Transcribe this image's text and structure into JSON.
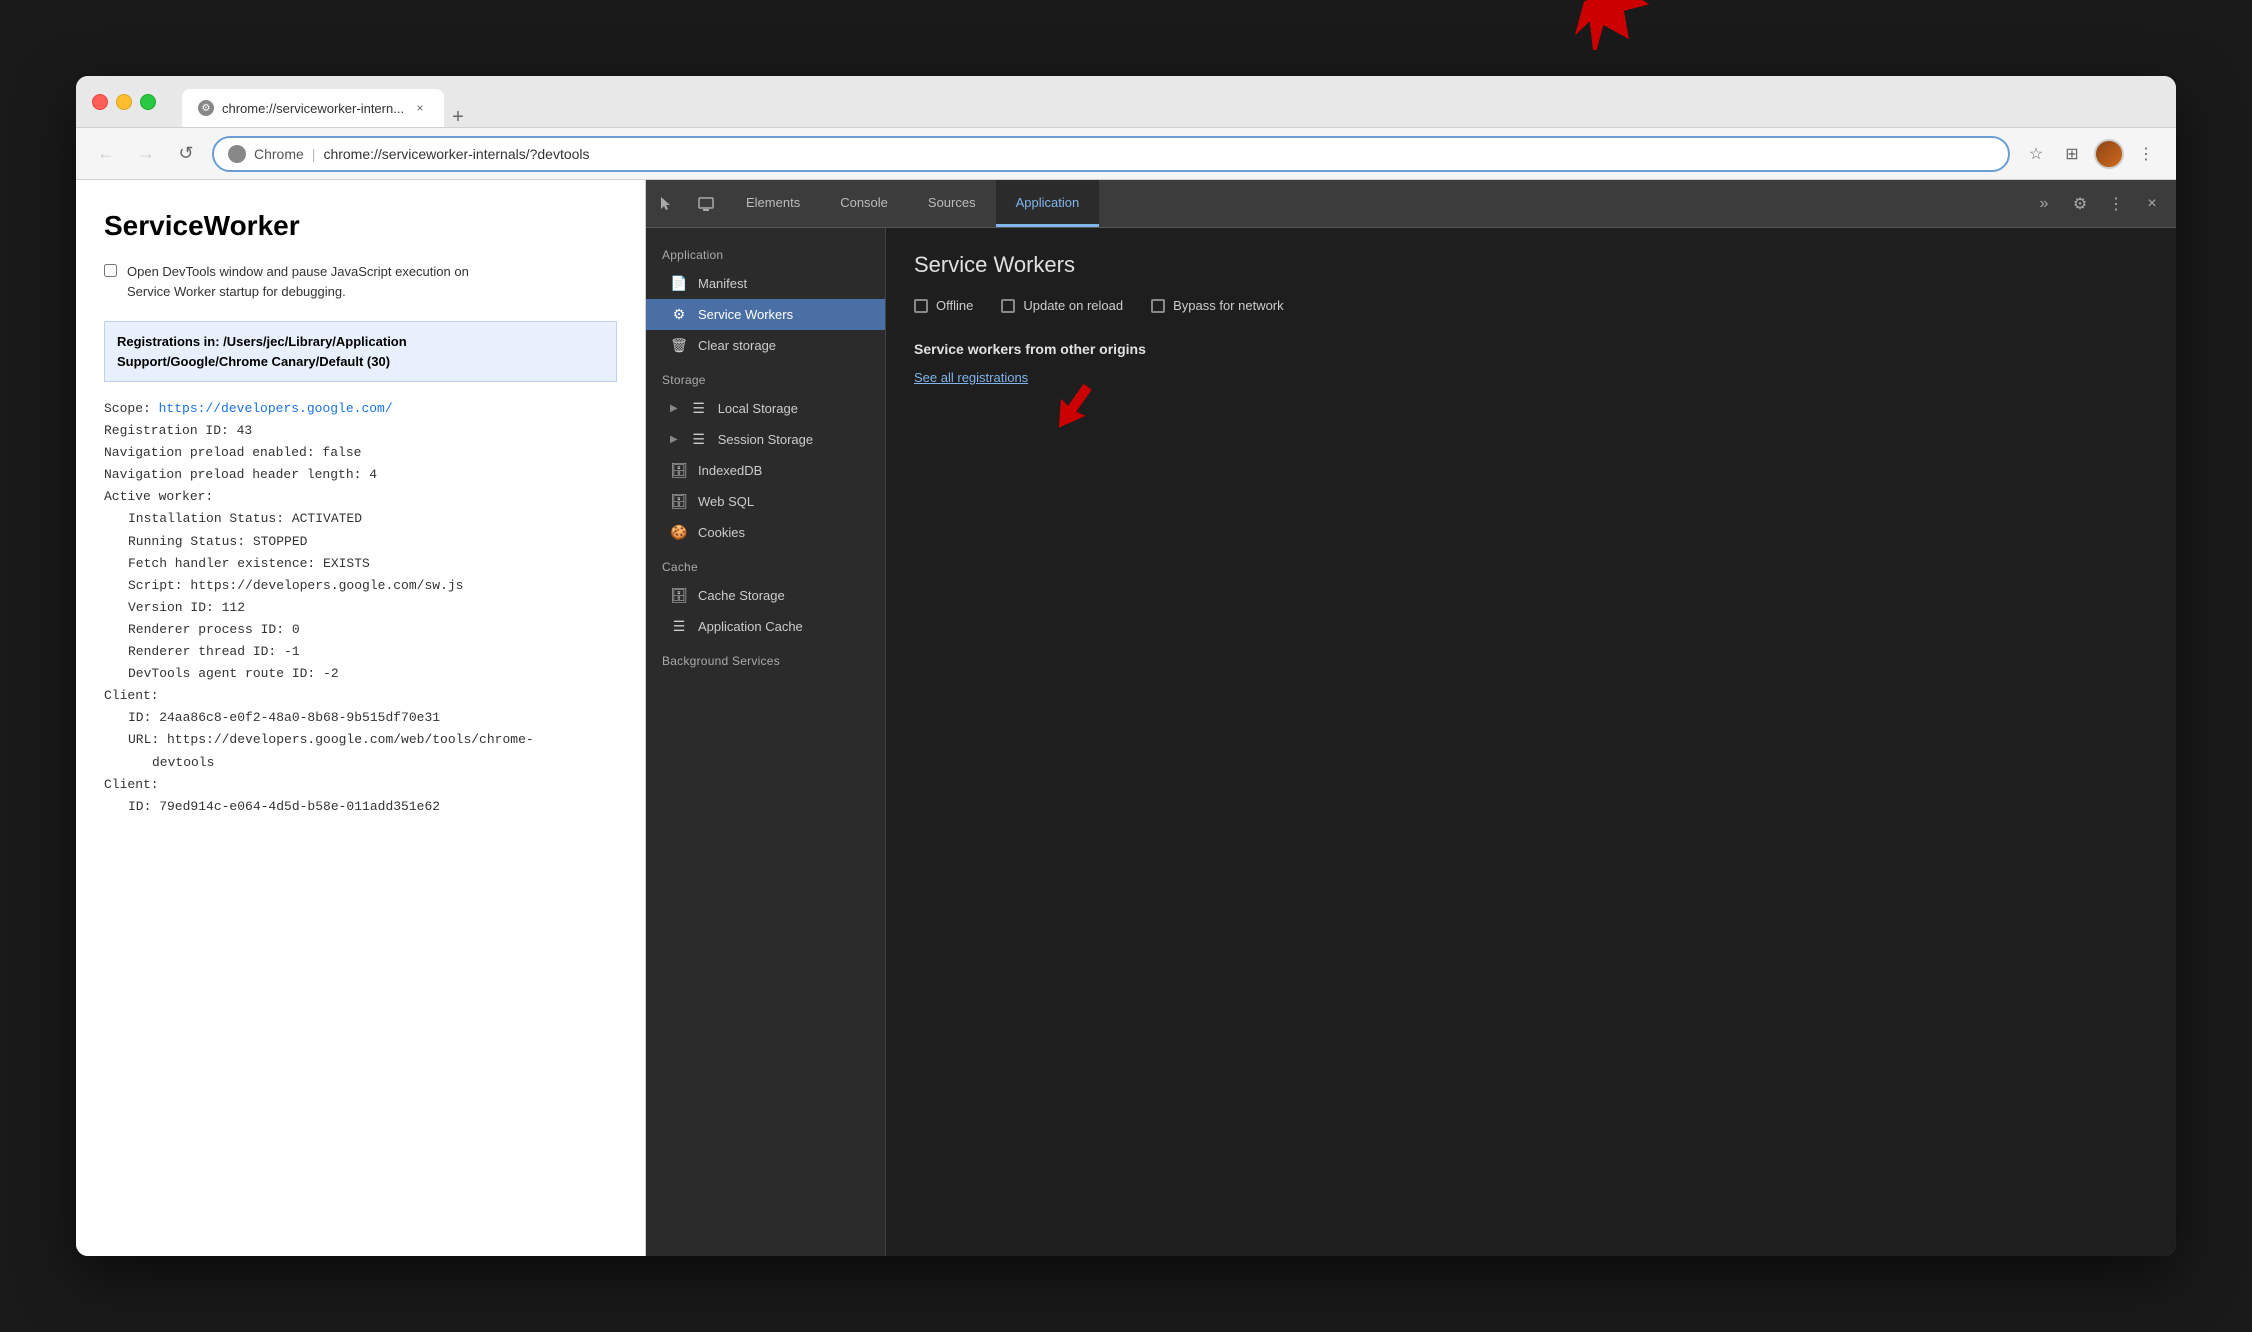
{
  "browser": {
    "traffic_lights": [
      "close",
      "minimize",
      "maximize"
    ],
    "tab": {
      "label": "chrome://serviceworker-intern...",
      "close_btn": "×"
    },
    "new_tab_btn": "+",
    "nav": {
      "back_btn": "←",
      "forward_btn": "→",
      "reload_btn": "↺",
      "address_chrome_part": "Chrome",
      "address_url": "chrome://serviceworker-internals/?devtools",
      "star_icon": "☆",
      "extension_icon": "⊞",
      "more_icon": "⋮"
    }
  },
  "page": {
    "title": "ServiceWorker",
    "checkbox_label": "Open DevTools window and pause JavaScript execution on\nService Worker startup for debugging.",
    "registrations_header_line1": "Registrations in: /Users/jec/Library/Application",
    "registrations_header_line2": "Support/Google/Chrome Canary/Default (30)",
    "scope_label": "Scope:",
    "scope_url": "https://developers.google.com/",
    "lines": [
      "Registration ID: 43",
      "Navigation preload enabled: false",
      "Navigation preload header length: 4",
      "Active worker:",
      "    Installation Status: ACTIVATED",
      "    Running Status: STOPPED",
      "    Fetch handler existence: EXISTS",
      "    Script: https://developers.google.com/sw.js",
      "    Version ID: 112",
      "    Renderer process ID: 0",
      "    Renderer thread ID: -1",
      "    DevTools agent route ID: -2",
      "Client:",
      "    ID: 24aa86c8-e0f2-48a0-8b68-9b515df70e31",
      "    URL: https://developers.google.com/web/tools/chrome-",
      "           devtools",
      "Client:",
      "    ID: 79ed914c-e064-4d5d-b58e-011add351e62"
    ]
  },
  "devtools": {
    "toolbar": {
      "cursor_icon": "↖",
      "device_icon": "▭",
      "tabs": [
        {
          "label": "Elements",
          "active": false
        },
        {
          "label": "Console",
          "active": false
        },
        {
          "label": "Sources",
          "active": false
        },
        {
          "label": "Application",
          "active": true
        }
      ],
      "more_tabs_icon": "»",
      "settings_icon": "⚙",
      "more_icon": "⋮",
      "close_icon": "×"
    },
    "sidebar": {
      "application_section": "Application",
      "application_items": [
        {
          "label": "Manifest",
          "icon": "📄",
          "active": false
        },
        {
          "label": "Service Workers",
          "icon": "⚙",
          "active": true
        },
        {
          "label": "Clear storage",
          "icon": "🗑",
          "active": false
        }
      ],
      "storage_section": "Storage",
      "storage_items": [
        {
          "label": "Local Storage",
          "icon": "☰",
          "has_expand": true
        },
        {
          "label": "Session Storage",
          "icon": "☰",
          "has_expand": true
        },
        {
          "label": "IndexedDB",
          "icon": "🗄"
        },
        {
          "label": "Web SQL",
          "icon": "🗄"
        },
        {
          "label": "Cookies",
          "icon": "🍪"
        }
      ],
      "cache_section": "Cache",
      "cache_items": [
        {
          "label": "Cache Storage",
          "icon": "🗄"
        },
        {
          "label": "Application Cache",
          "icon": "☰"
        }
      ],
      "background_section": "Background Services"
    },
    "main_panel": {
      "title": "Service Workers",
      "options": [
        {
          "label": "Offline"
        },
        {
          "label": "Update on reload"
        },
        {
          "label": "Bypass for network"
        }
      ],
      "other_origins_title": "Service workers from other origins",
      "see_all_link": "See all registrations"
    }
  }
}
